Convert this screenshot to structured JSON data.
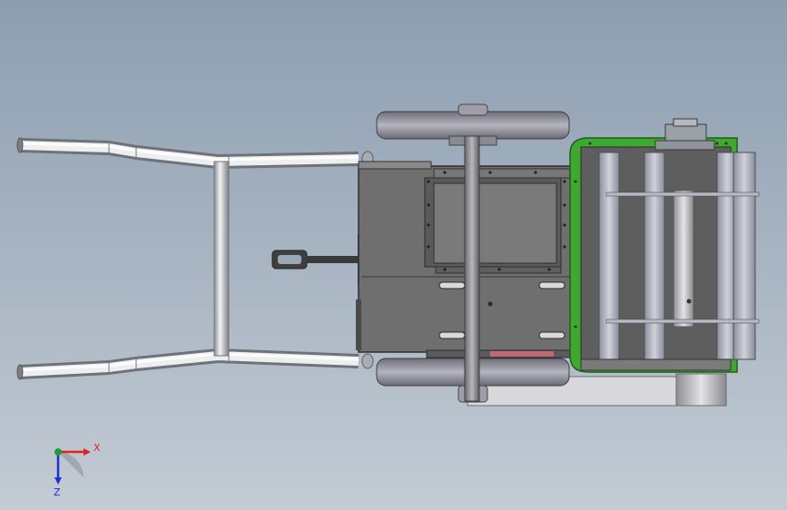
{
  "colors": {
    "background_top": "#8d9eb1",
    "background_bottom": "#c3cbd4",
    "frame_green": "#3fa830",
    "body_gray": "#6d6d6d",
    "wheel_gray": "#8f8f9a",
    "axis_x": "#e0221b",
    "axis_y": "#19a03a",
    "axis_z": "#1c2fd6"
  },
  "triad": {
    "x_label": "X",
    "z_label": "Z"
  },
  "icons": [
    "coordinate-triad-icon"
  ]
}
